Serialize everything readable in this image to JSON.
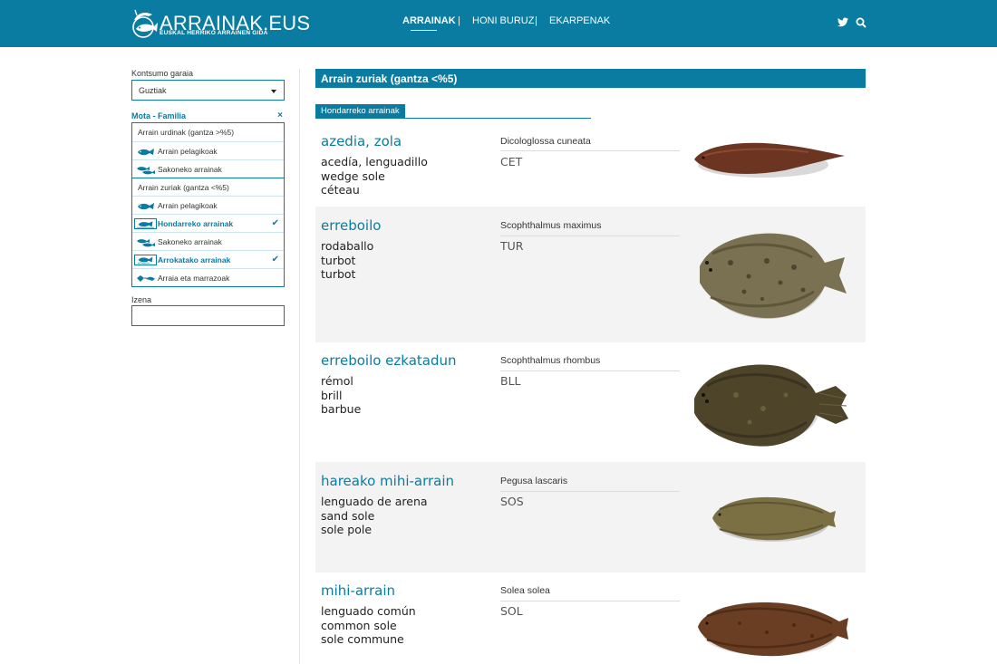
{
  "header": {
    "logo_title": "ARRAINAK.EUS",
    "logo_subtitle": "EUSKAL HERRIKO ARRAINEN GIDA",
    "nav": [
      {
        "label": "ARRAINAK",
        "active": true
      },
      {
        "label": "HONI BURUZ",
        "active": false
      },
      {
        "label": "EKARPENAK",
        "active": false
      }
    ],
    "separator": "|",
    "icons": [
      "twitter-icon",
      "search-icon"
    ],
    "bar_color": "#0a7ca1"
  },
  "sidebar": {
    "season_label": "Kontsumo garaia",
    "season_value": "Guztiak",
    "family_label": "Mota - Familia",
    "family_close": "×",
    "families": [
      {
        "label": "Arrain urdinak (gantza >%5)",
        "group": true
      },
      {
        "label": "Arrain pelagikoak",
        "group": false,
        "selected": false
      },
      {
        "label": "Sakoneko arrainak",
        "group": false,
        "selected": false
      },
      {
        "label": "Arrain zuriak (gantza <%5)",
        "group": true
      },
      {
        "label": "Arrain pelagikoak",
        "group": false,
        "selected": false
      },
      {
        "label": "Hondarreko arrainak",
        "group": false,
        "selected": true
      },
      {
        "label": "Sakoneko arrainak",
        "group": false,
        "selected": false
      },
      {
        "label": "Arrokatako arrainak",
        "group": false,
        "selected": true
      },
      {
        "label": "Arraia eta marrazoak",
        "group": false,
        "selected": false
      }
    ],
    "name_label": "Izena",
    "name_value": ""
  },
  "main": {
    "section_title": "Arrain zuriak (gantza <%5)",
    "subsection": "Hondarreko arrainak",
    "fish": [
      {
        "name": "azedia, zola",
        "common": [
          "acedía, lenguadillo",
          "wedge sole",
          "céteau"
        ],
        "scientific": "Dicologlossa cuneata",
        "code": "CET"
      },
      {
        "name": "erreboilo",
        "common": [
          "rodaballo",
          "turbot",
          "turbot"
        ],
        "scientific": "Scophthalmus maximus",
        "code": "TUR"
      },
      {
        "name": "erreboilo ezkatadun",
        "common": [
          "rémol",
          "brill",
          "barbue"
        ],
        "scientific": "Scophthalmus rhombus",
        "code": "BLL"
      },
      {
        "name": "hareako mihi-arrain",
        "common": [
          "lenguado de arena",
          "sand sole",
          "sole pole"
        ],
        "scientific": "Pegusa lascaris",
        "code": "SOS"
      },
      {
        "name": "mihi-arrain",
        "common": [
          "lenguado común",
          "common sole",
          "sole commune"
        ],
        "scientific": "Solea solea",
        "code": "SOL"
      }
    ]
  }
}
